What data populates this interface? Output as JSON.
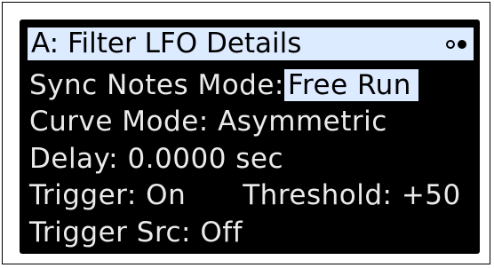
{
  "panel": {
    "title": "A: Filter LFO Details",
    "page_indicator": [
      "page-dot-inactive",
      "page-dot-active"
    ]
  },
  "params": {
    "sync_notes_mode": {
      "label": "Sync Notes Mode:",
      "value": "Free Run"
    },
    "curve_mode": {
      "label": "Curve Mode:",
      "value": "Asymmetric"
    },
    "delay": {
      "label": "Delay:",
      "value": "0.0000 sec"
    },
    "trigger": {
      "label": "Trigger:",
      "value": "On"
    },
    "threshold": {
      "label": "Threshold:",
      "value": "+50"
    },
    "trigger_src": {
      "label": "Trigger Src:",
      "value": "Off"
    }
  },
  "colors": {
    "screen_background": "#000000",
    "text": "#eaeaea",
    "highlight": "#dcebff",
    "highlight_text": "#000000"
  }
}
